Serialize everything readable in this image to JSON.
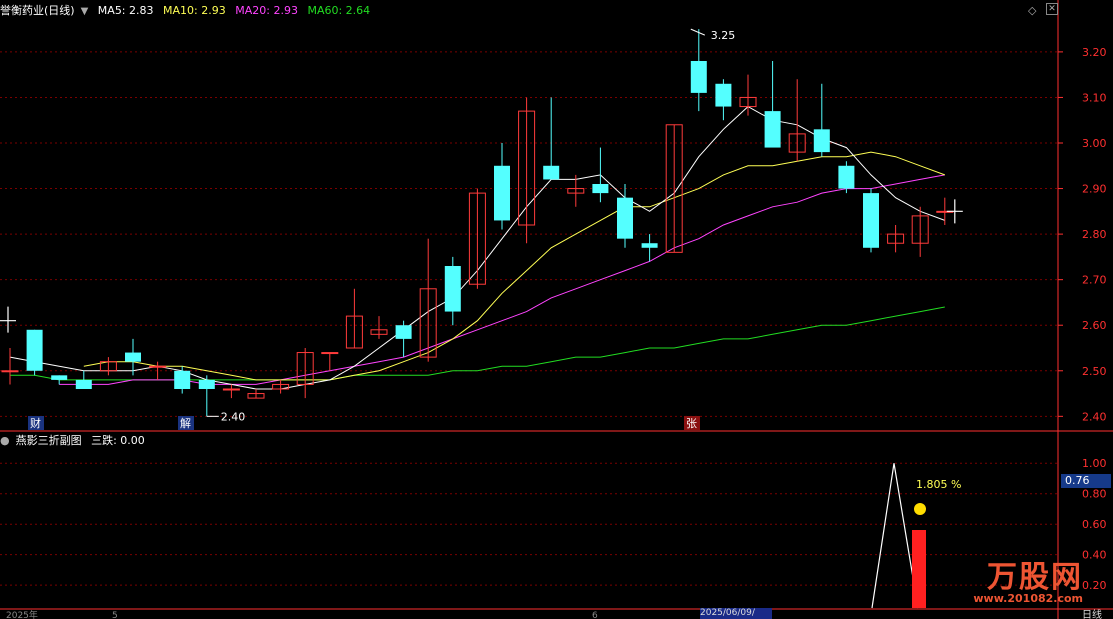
{
  "header": {
    "stock": "誉衡药业(日线)",
    "ma": [
      {
        "label": "MA5: 2.83",
        "color": "#ffffff"
      },
      {
        "label": "MA10: 2.93",
        "color": "#ffff55"
      },
      {
        "label": "MA20: 2.93",
        "color": "#ff44ff"
      },
      {
        "label": "MA60: 2.64",
        "color": "#22dd22"
      }
    ]
  },
  "sub_header": {
    "name": "燕影三折副图",
    "value": "三跌: 0.00"
  },
  "colors": {
    "up": "#ff3b3b",
    "down": "#54ffff",
    "ma5": "#ffffff",
    "ma10": "#ffff55",
    "ma20": "#ff44ff",
    "ma60": "#22dd22",
    "grid": "#7a0000",
    "axis": "#ff3030"
  },
  "markers": {
    "cai": "财",
    "jie": "解",
    "zhang": "张"
  },
  "high_label": "3.25",
  "low_label": "2.40",
  "pct_label": "1.805 %",
  "value_box": "0.76",
  "bottom_axis": [
    "2025年",
    "5",
    "6",
    "2025/06/09/"
  ],
  "bottom_right": "日线",
  "watermark": {
    "logo": "万股网",
    "url": "www.201082.com"
  },
  "chart_data": {
    "type": "candlestick",
    "ylim": [
      2.37,
      3.27
    ],
    "yticks": [
      2.4,
      2.5,
      2.6,
      2.7,
      2.8,
      2.9,
      3.0,
      3.1,
      3.2
    ],
    "ytick_labels": [
      "2.40",
      "2.50",
      "2.60",
      "2.70",
      "2.80",
      "2.90",
      "3.00",
      "3.10",
      "3.20"
    ],
    "candles": [
      {
        "o": 2.5,
        "h": 2.55,
        "l": 2.47,
        "c": 2.5
      },
      {
        "o": 2.59,
        "h": 2.59,
        "l": 2.49,
        "c": 2.5
      },
      {
        "o": 2.49,
        "h": 2.49,
        "l": 2.47,
        "c": 2.48
      },
      {
        "o": 2.48,
        "h": 2.5,
        "l": 2.46,
        "c": 2.46
      },
      {
        "o": 2.5,
        "h": 2.53,
        "l": 2.49,
        "c": 2.52
      },
      {
        "o": 2.54,
        "h": 2.57,
        "l": 2.49,
        "c": 2.52
      },
      {
        "o": 2.51,
        "h": 2.52,
        "l": 2.48,
        "c": 2.51
      },
      {
        "o": 2.5,
        "h": 2.51,
        "l": 2.45,
        "c": 2.46
      },
      {
        "o": 2.48,
        "h": 2.49,
        "l": 2.4,
        "c": 2.46
      },
      {
        "o": 2.46,
        "h": 2.47,
        "l": 2.44,
        "c": 2.46
      },
      {
        "o": 2.44,
        "h": 2.46,
        "l": 2.44,
        "c": 2.45
      },
      {
        "o": 2.46,
        "h": 2.48,
        "l": 2.45,
        "c": 2.47
      },
      {
        "o": 2.47,
        "h": 2.55,
        "l": 2.44,
        "c": 2.54
      },
      {
        "o": 2.54,
        "h": 2.54,
        "l": 2.5,
        "c": 2.54
      },
      {
        "o": 2.55,
        "h": 2.68,
        "l": 2.55,
        "c": 2.62
      },
      {
        "o": 2.58,
        "h": 2.62,
        "l": 2.57,
        "c": 2.59
      },
      {
        "o": 2.6,
        "h": 2.61,
        "l": 2.53,
        "c": 2.57
      },
      {
        "o": 2.53,
        "h": 2.79,
        "l": 2.52,
        "c": 2.68
      },
      {
        "o": 2.73,
        "h": 2.75,
        "l": 2.6,
        "c": 2.63
      },
      {
        "o": 2.69,
        "h": 2.9,
        "l": 2.68,
        "c": 2.89
      },
      {
        "o": 2.95,
        "h": 3.0,
        "l": 2.81,
        "c": 2.83
      },
      {
        "o": 2.82,
        "h": 3.1,
        "l": 2.78,
        "c": 3.07
      },
      {
        "o": 2.95,
        "h": 3.1,
        "l": 2.92,
        "c": 2.92
      },
      {
        "o": 2.89,
        "h": 2.93,
        "l": 2.86,
        "c": 2.9
      },
      {
        "o": 2.91,
        "h": 2.99,
        "l": 2.87,
        "c": 2.89
      },
      {
        "o": 2.88,
        "h": 2.91,
        "l": 2.77,
        "c": 2.79
      },
      {
        "o": 2.78,
        "h": 2.8,
        "l": 2.74,
        "c": 2.77
      },
      {
        "o": 2.76,
        "h": 3.04,
        "l": 2.76,
        "c": 3.04
      },
      {
        "o": 3.18,
        "h": 3.25,
        "l": 3.07,
        "c": 3.11
      },
      {
        "o": 3.13,
        "h": 3.14,
        "l": 3.05,
        "c": 3.08
      },
      {
        "o": 3.08,
        "h": 3.15,
        "l": 3.06,
        "c": 3.1
      },
      {
        "o": 3.07,
        "h": 3.18,
        "l": 3.01,
        "c": 2.99
      },
      {
        "o": 2.98,
        "h": 3.14,
        "l": 2.96,
        "c": 3.02
      },
      {
        "o": 3.03,
        "h": 3.13,
        "l": 2.97,
        "c": 2.98
      },
      {
        "o": 2.95,
        "h": 2.96,
        "l": 2.89,
        "c": 2.9
      },
      {
        "o": 2.89,
        "h": 2.9,
        "l": 2.76,
        "c": 2.77
      },
      {
        "o": 2.78,
        "h": 2.82,
        "l": 2.76,
        "c": 2.8
      },
      {
        "o": 2.78,
        "h": 2.86,
        "l": 2.75,
        "c": 2.84
      },
      {
        "o": 2.85,
        "h": 2.88,
        "l": 2.82,
        "c": 2.85
      }
    ],
    "ma5": [
      2.53,
      2.52,
      2.51,
      2.5,
      2.5,
      2.5,
      2.51,
      2.5,
      2.48,
      2.47,
      2.46,
      2.46,
      2.47,
      2.48,
      2.51,
      2.55,
      2.59,
      2.63,
      2.66,
      2.72,
      2.79,
      2.86,
      2.92,
      2.92,
      2.93,
      2.88,
      2.85,
      2.89,
      2.97,
      3.03,
      3.08,
      3.05,
      3.04,
      3.01,
      2.99,
      2.93,
      2.88,
      2.85,
      2.83
    ],
    "ma10": [
      null,
      null,
      null,
      2.51,
      2.52,
      2.52,
      2.51,
      2.51,
      2.5,
      2.49,
      2.48,
      2.48,
      2.48,
      2.48,
      2.49,
      2.5,
      2.52,
      2.54,
      2.57,
      2.61,
      2.67,
      2.72,
      2.77,
      2.8,
      2.83,
      2.86,
      2.86,
      2.88,
      2.9,
      2.93,
      2.95,
      2.95,
      2.96,
      2.97,
      2.97,
      2.98,
      2.97,
      2.95,
      2.93
    ],
    "ma20": [
      null,
      null,
      2.47,
      2.47,
      2.47,
      2.48,
      2.48,
      2.48,
      2.47,
      2.47,
      2.47,
      2.48,
      2.49,
      2.5,
      2.51,
      2.52,
      2.53,
      2.55,
      2.57,
      2.59,
      2.61,
      2.63,
      2.66,
      2.68,
      2.7,
      2.72,
      2.74,
      2.77,
      2.79,
      2.82,
      2.84,
      2.86,
      2.87,
      2.89,
      2.9,
      2.9,
      2.91,
      2.92,
      2.93
    ],
    "ma60": [
      2.49,
      2.49,
      2.48,
      2.48,
      2.48,
      2.48,
      2.48,
      2.48,
      2.48,
      2.48,
      2.48,
      2.48,
      2.48,
      2.48,
      2.49,
      2.49,
      2.49,
      2.49,
      2.5,
      2.5,
      2.51,
      2.51,
      2.52,
      2.53,
      2.53,
      2.54,
      2.55,
      2.55,
      2.56,
      2.57,
      2.57,
      2.58,
      2.59,
      2.6,
      2.6,
      2.61,
      2.62,
      2.63,
      2.64
    ],
    "sub_ylim": [
      0.05,
      1.1
    ],
    "sub_yticks": [
      0.2,
      0.4,
      0.6,
      0.8,
      1.0
    ],
    "sub_ytick_labels": [
      "0.20",
      "0.40",
      "0.60",
      "0.80",
      "1.00"
    ]
  }
}
